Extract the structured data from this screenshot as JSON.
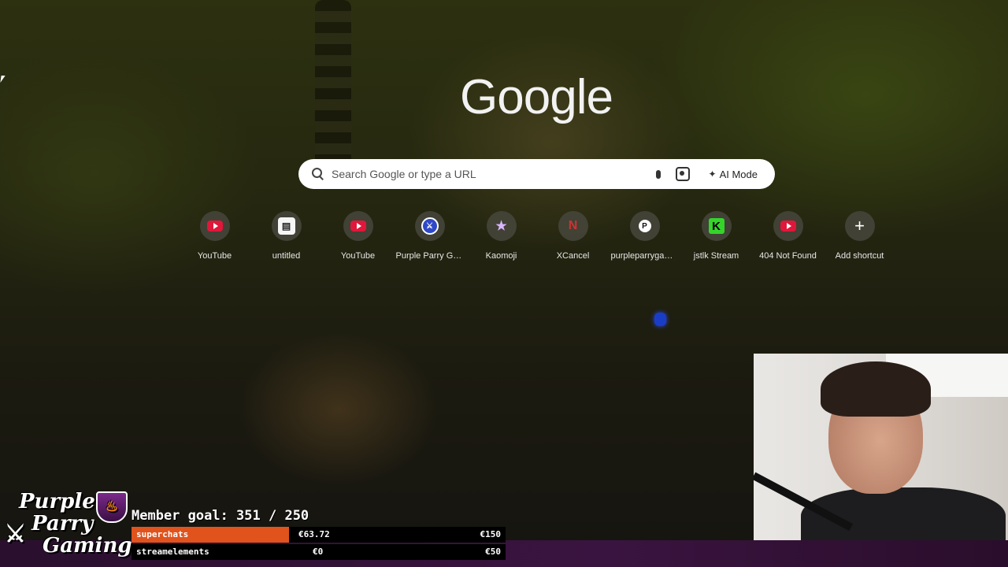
{
  "google": {
    "logo": "Google",
    "search_placeholder": "Search Google or type a URL",
    "ai_mode_label": "AI Mode",
    "icons": {
      "search": "search-icon",
      "mic": "microphone-icon",
      "lens": "camera-search-icon",
      "ai": "sparkle-search-icon"
    }
  },
  "shortcuts": [
    {
      "label": "YouTube",
      "icon": "youtube-icon",
      "glyph": ""
    },
    {
      "label": "untitled",
      "icon": "document-icon",
      "glyph": "▤"
    },
    {
      "label": "YouTube",
      "icon": "youtube-icon",
      "glyph": ""
    },
    {
      "label": "Purple Parry Ga...",
      "icon": "purple-parry-icon",
      "glyph": "⚔"
    },
    {
      "label": "Kaomoji",
      "icon": "star-icon",
      "glyph": "★"
    },
    {
      "label": "XCancel",
      "icon": "xcancel-icon",
      "glyph": "N"
    },
    {
      "label": "purpleparrygam...",
      "icon": "patreon-icon",
      "glyph": "P"
    },
    {
      "label": "jstlk Stream",
      "icon": "kick-icon",
      "glyph": "K"
    },
    {
      "label": "404 Not Found",
      "icon": "youtube-icon",
      "glyph": ""
    },
    {
      "label": "Add shortcut",
      "icon": "plus-icon",
      "glyph": "+"
    }
  ],
  "overlay": {
    "brand_line1": "Purple",
    "brand_line2": "Parry",
    "brand_line3": "Gaming",
    "member_goal": "Member goal: 351 / 250",
    "bars": [
      {
        "name": "superchats",
        "current": "€63.72",
        "target": "€150",
        "progress": 0.42
      },
      {
        "name": "streamelements",
        "current": "€0",
        "target": "€50",
        "progress": 0
      }
    ],
    "colors": {
      "bar_fill": "#e0531d",
      "band": "#3a1440"
    }
  }
}
